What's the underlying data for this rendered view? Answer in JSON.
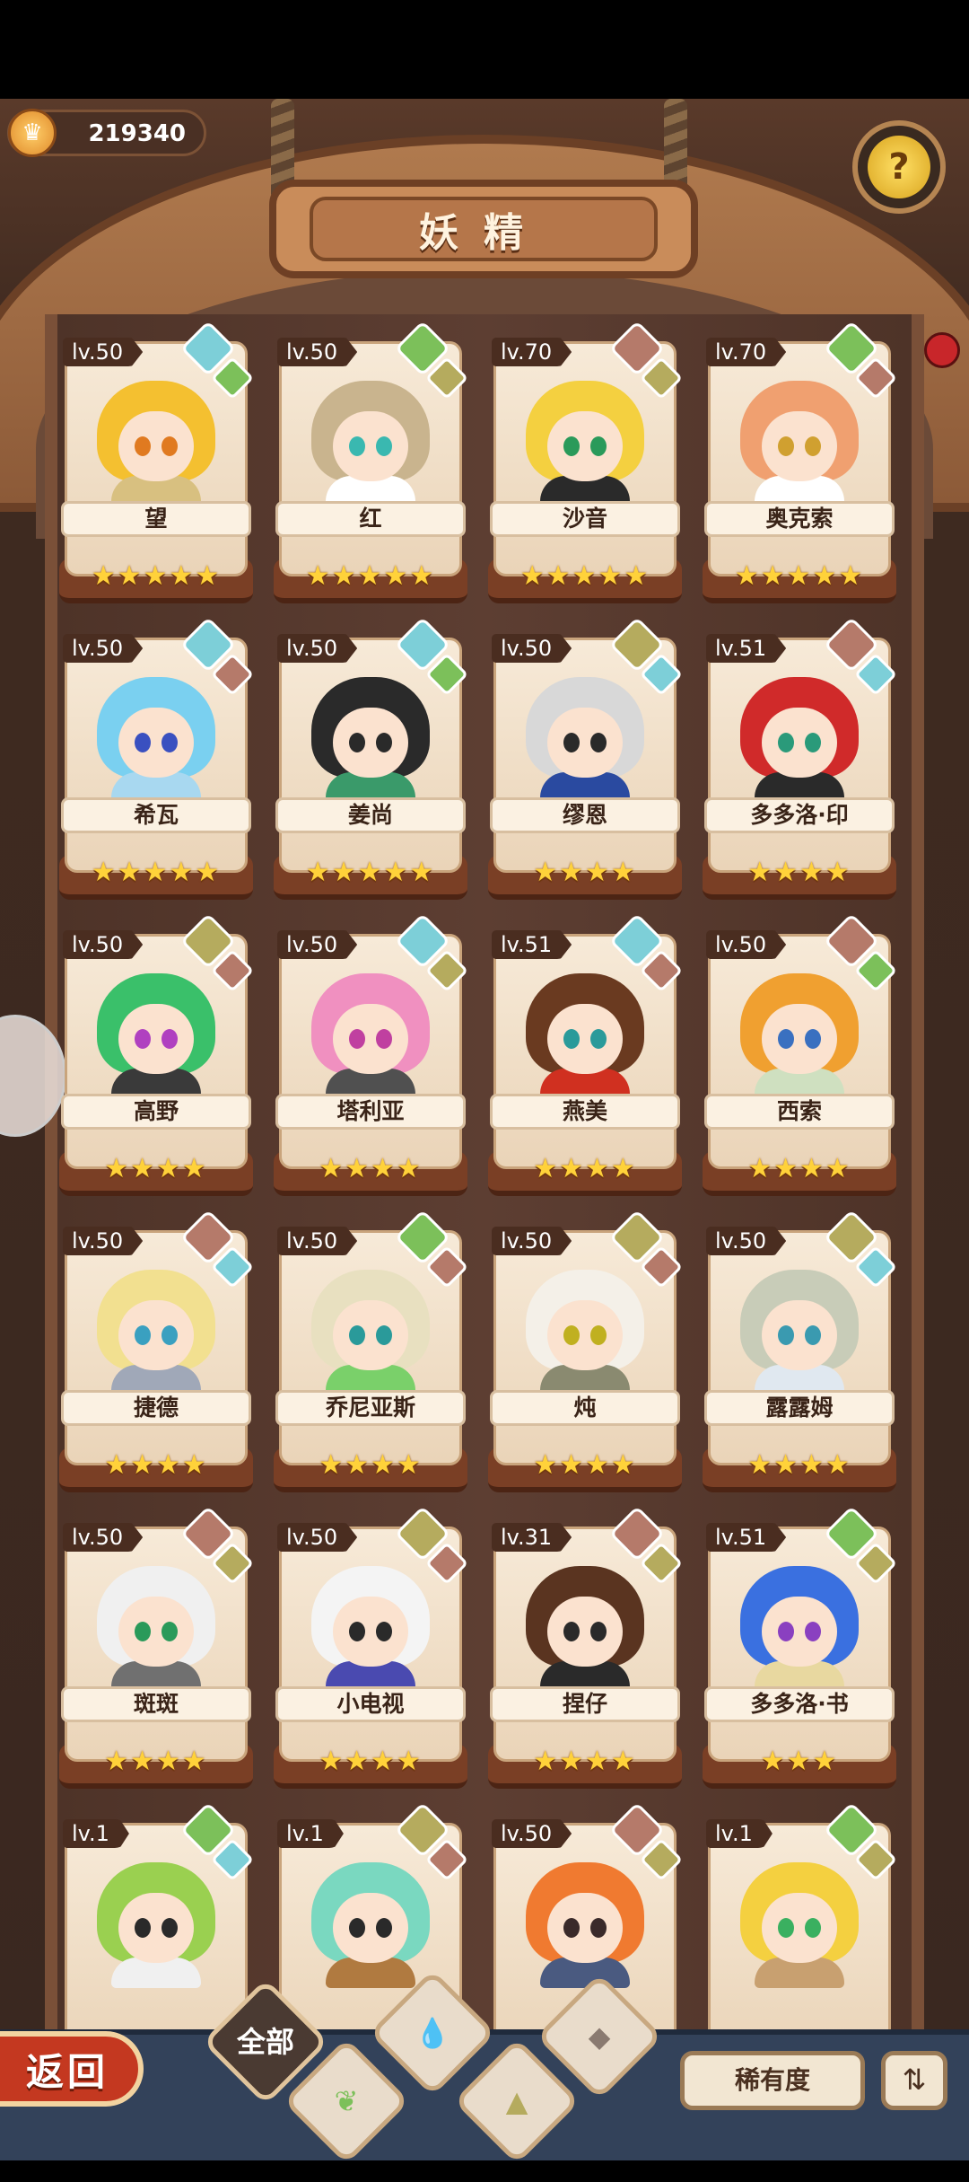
{
  "header": {
    "coins": "219340",
    "title": "妖精",
    "help_label": "?"
  },
  "fairies": [
    {
      "level": "lv.50",
      "name": "望",
      "stars": 5,
      "hair": "#f4c030",
      "outfit": "#d8c080",
      "eyes": "#e07a20",
      "el": [
        "water",
        "leaf"
      ]
    },
    {
      "level": "lv.50",
      "name": "红",
      "stars": 5,
      "hair": "#c9b48e",
      "outfit": "#ffffff",
      "eyes": "#3ab8b0",
      "el": [
        "leaf",
        "earth"
      ]
    },
    {
      "level": "lv.70",
      "name": "沙音",
      "stars": 5,
      "hair": "#f4d040",
      "outfit": "#2a2a2a",
      "eyes": "#2a9a5a",
      "el": [
        "rock",
        "earth"
      ]
    },
    {
      "level": "lv.70",
      "name": "奥克索",
      "stars": 5,
      "hair": "#f0a070",
      "outfit": "#ffffff",
      "eyes": "#d0a030",
      "el": [
        "leaf",
        "rock"
      ]
    },
    {
      "level": "lv.50",
      "name": "希瓦",
      "stars": 5,
      "hair": "#7ad0f0",
      "outfit": "#a8d8f0",
      "eyes": "#3a50c0",
      "el": [
        "water",
        "rock"
      ]
    },
    {
      "level": "lv.50",
      "name": "姜尚",
      "stars": 5,
      "hair": "#2a2a2a",
      "outfit": "#3a9a6a",
      "eyes": "#2a2a2a",
      "el": [
        "water",
        "leaf"
      ]
    },
    {
      "level": "lv.50",
      "name": "缪恩",
      "stars": 4,
      "hair": "#d8d8d8",
      "outfit": "#2a4aa0",
      "eyes": "#2a2a2a",
      "el": [
        "earth",
        "water"
      ]
    },
    {
      "level": "lv.51",
      "name": "多多洛·印",
      "stars": 4,
      "hair": "#d02a2a",
      "outfit": "#2a2a2a",
      "eyes": "#2a9a7a",
      "el": [
        "rock",
        "water"
      ]
    },
    {
      "level": "lv.50",
      "name": "高野",
      "stars": 4,
      "hair": "#3ac06a",
      "outfit": "#3a3a3a",
      "eyes": "#b040c0",
      "el": [
        "earth",
        "rock"
      ]
    },
    {
      "level": "lv.50",
      "name": "塔利亚",
      "stars": 4,
      "hair": "#f090c0",
      "outfit": "#505050",
      "eyes": "#c040a0",
      "el": [
        "water",
        "earth"
      ]
    },
    {
      "level": "lv.51",
      "name": "燕美",
      "stars": 4,
      "hair": "#6a3a20",
      "outfit": "#d03020",
      "eyes": "#2a9a9a",
      "el": [
        "water",
        "rock"
      ]
    },
    {
      "level": "lv.50",
      "name": "西索",
      "stars": 4,
      "hair": "#f0a030",
      "outfit": "#cfe0c0",
      "eyes": "#3a70c0",
      "el": [
        "rock",
        "leaf"
      ]
    },
    {
      "level": "lv.50",
      "name": "捷德",
      "stars": 4,
      "hair": "#f2e090",
      "outfit": "#a0a8b8",
      "eyes": "#3aa0c0",
      "el": [
        "rock",
        "water"
      ]
    },
    {
      "level": "lv.50",
      "name": "乔尼亚斯",
      "stars": 4,
      "hair": "#e8e0c0",
      "outfit": "#7ad06a",
      "eyes": "#2a9a9a",
      "el": [
        "leaf",
        "rock"
      ]
    },
    {
      "level": "lv.50",
      "name": "炖",
      "stars": 4,
      "hair": "#f4f0e8",
      "outfit": "#8a8a70",
      "eyes": "#c0b020",
      "el": [
        "earth",
        "rock"
      ]
    },
    {
      "level": "lv.50",
      "name": "露露姆",
      "stars": 4,
      "hair": "#c8ccb8",
      "outfit": "#e0e8f0",
      "eyes": "#3a9ab0",
      "el": [
        "earth",
        "water"
      ]
    },
    {
      "level": "lv.50",
      "name": "斑斑",
      "stars": 4,
      "hair": "#f0f0f0",
      "outfit": "#707070",
      "eyes": "#2a9a5a",
      "el": [
        "rock",
        "earth"
      ]
    },
    {
      "level": "lv.50",
      "name": "小电视",
      "stars": 4,
      "hair": "#f4f4f4",
      "outfit": "#4a4ab0",
      "eyes": "#2a2a2a",
      "el": [
        "earth",
        "rock"
      ]
    },
    {
      "level": "lv.31",
      "name": "捏仔",
      "stars": 4,
      "hair": "#5a3420",
      "outfit": "#2a2a2a",
      "eyes": "#2a2a2a",
      "el": [
        "rock",
        "earth"
      ]
    },
    {
      "level": "lv.51",
      "name": "多多洛·书",
      "stars": 3,
      "hair": "#3a70e0",
      "outfit": "#e8d8a0",
      "eyes": "#8a40c0",
      "el": [
        "leaf",
        "earth"
      ]
    },
    {
      "level": "lv.1",
      "name": "",
      "stars": 0,
      "hair": "#9ad050",
      "outfit": "#f0f0f0",
      "eyes": "#2a2a2a",
      "el": [
        "leaf",
        "water"
      ]
    },
    {
      "level": "lv.1",
      "name": "",
      "stars": 0,
      "hair": "#7ad8c0",
      "outfit": "#b07a40",
      "eyes": "#2a2a2a",
      "el": [
        "earth",
        "rock"
      ]
    },
    {
      "level": "lv.50",
      "name": "",
      "stars": 0,
      "hair": "#f07a30",
      "outfit": "#4a5a80",
      "eyes": "#3a2a2a",
      "el": [
        "rock",
        "earth"
      ]
    },
    {
      "level": "lv.1",
      "name": "",
      "stars": 0,
      "hair": "#f4d040",
      "outfit": "#c8a070",
      "eyes": "#3ab060",
      "el": [
        "leaf",
        "earth"
      ]
    }
  ],
  "footer": {
    "back_label": "返回",
    "filter_all_label": "全部",
    "filter_icons": [
      "leaf-icon",
      "water-icon",
      "earth-icon",
      "rock-icon"
    ],
    "sort_label": "稀有度",
    "order_icon": "sort-order-icon"
  },
  "colors": {
    "star": "#ffd23a",
    "water": "#7dcfd8",
    "leaf": "#7cc05a",
    "earth": "#b5ab5e",
    "rock": "#b57a6a"
  }
}
